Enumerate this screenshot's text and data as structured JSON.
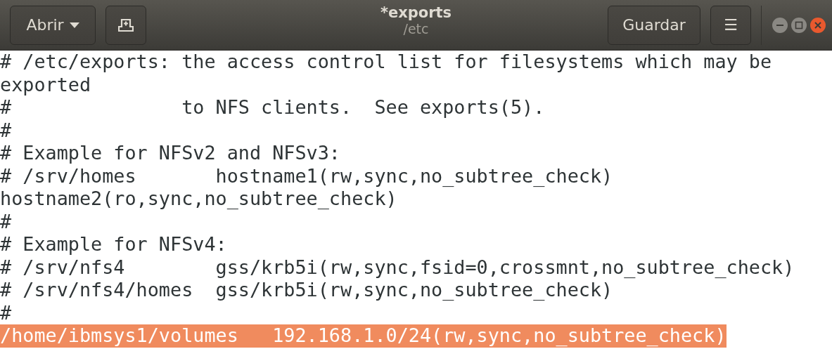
{
  "header": {
    "open_button": "Abrir",
    "title": "*exports",
    "subtitle": "/etc",
    "save_button": "Guardar",
    "menu_button": "☰"
  },
  "lines": [
    {
      "text": "# /etc/exports: the access control list for filesystems which may be",
      "selected": false
    },
    {
      "text": "exported",
      "selected": false
    },
    {
      "text": "#               to NFS clients.  See exports(5).",
      "selected": false
    },
    {
      "text": "#",
      "selected": false
    },
    {
      "text": "# Example for NFSv2 and NFSv3:",
      "selected": false
    },
    {
      "text": "# /srv/homes       hostname1(rw,sync,no_subtree_check)",
      "selected": false
    },
    {
      "text": "hostname2(ro,sync,no_subtree_check)",
      "selected": false
    },
    {
      "text": "#",
      "selected": false
    },
    {
      "text": "# Example for NFSv4:",
      "selected": false
    },
    {
      "text": "# /srv/nfs4        gss/krb5i(rw,sync,fsid=0,crossmnt,no_subtree_check)",
      "selected": false
    },
    {
      "text": "# /srv/nfs4/homes  gss/krb5i(rw,sync,no_subtree_check)",
      "selected": false
    },
    {
      "text": "#",
      "selected": false
    },
    {
      "text": "/home/ibmsys1/volumes   192.168.1.0/24(rw,sync,no_subtree_check)",
      "selected": true
    }
  ]
}
